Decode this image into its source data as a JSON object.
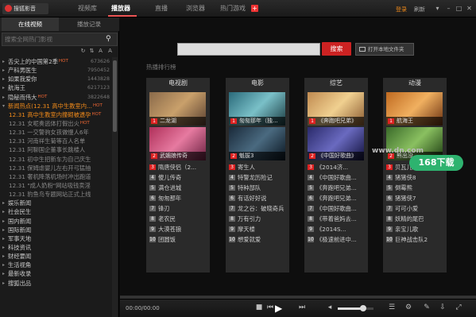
{
  "topbar": {
    "logo_label": "搜狐影音",
    "tabs": [
      "视频库",
      "播放器",
      "直播",
      "浏览器",
      "热门游戏"
    ],
    "active_tab": "播放器",
    "login": "登录",
    "refresh": "刷新"
  },
  "sidebar": {
    "tabs": [
      "在线视频",
      "播放记录"
    ],
    "search_placeholder": "搜索全网热门影视",
    "items": [
      {
        "label": "舌尖上的中国第2季",
        "hot": "HOT",
        "count": "673626"
      },
      {
        "label": "产科男医生",
        "count": "7950452"
      },
      {
        "label": "如果我爱你",
        "count": "1443828"
      },
      {
        "label": "航海王",
        "count": "6217123"
      },
      {
        "label": "隐秘而伟大",
        "hot": "HOT",
        "count": "3822648"
      }
    ],
    "news_header": {
      "label": "新闻热点(12.31 高中生教室内...",
      "hot": "HOT"
    },
    "news": [
      {
        "date": "12.31",
        "label": "高中生教室内撞砌被遗孕",
        "hot": "HOT",
        "highlight": true
      },
      {
        "date": "12.31",
        "label": "女呢奏逃体打假出火",
        "hot": "HOT"
      },
      {
        "date": "12.31",
        "label": "一交警驹女孩做慢人6年"
      },
      {
        "date": "12.31",
        "label": "河南祥生菊等百人名单"
      },
      {
        "date": "12.31",
        "label": "阿聊国企董事长跳楼人"
      },
      {
        "date": "12.31",
        "label": "初中生招新车为自己庆生"
      },
      {
        "date": "12.31",
        "label": "保姆虐婴儿左右开弓猛抽"
      },
      {
        "date": "12.31",
        "label": "奢机降落机场时冲出跑道"
      },
      {
        "date": "12.31",
        "label": "\"成人奶粉\"网站吸钱卖淫"
      },
      {
        "date": "12.31",
        "label": "豹鱼鸟专题网站正式上线"
      }
    ],
    "categories": [
      "娱乐新闻",
      "社会民生",
      "国内新闻",
      "国际新闻",
      "军事天地",
      "科技资讯",
      "财经要闻",
      "生活视角",
      "最新收录",
      "搜狐出品"
    ]
  },
  "main": {
    "search_button": "搜索",
    "open_folder": "打开本地文件夹",
    "rank_title": "热播排行榜",
    "columns": [
      {
        "title": "电视剧",
        "posters": [
          "二龙湖",
          "武媚娘传奇"
        ],
        "items": [
          "隋唐侠侣（2...",
          "傻儿传奇",
          "满仓进城",
          "匆匆那年",
          "锋刃",
          "老农民",
          "大漠苍狼",
          "团圆饭"
        ]
      },
      {
        "title": "电影",
        "posters": [
          "匆匆那年（独...",
          "魁拔3"
        ],
        "items": [
          "寄生人",
          "特警龙历险记",
          "特种部队",
          "有话好好说",
          "龙之谷：破晓奇兵",
          "万有引力",
          "摩天楼",
          "想爱就爱"
        ]
      },
      {
        "title": "综艺",
        "posters": [
          "《奔跑吧兄弟》",
          "《中国好歌曲》"
        ],
        "items": [
          "《2014济...",
          "《中国好歌曲...",
          "《奔跑吧兄弟...",
          "《奔跑吧兄弟...",
          "《中国好歌曲...",
          "《带着爸妈去...",
          "《2014S...",
          "《极速前进中..."
        ]
      },
      {
        "title": "动漫",
        "posters": [
          "航海王",
          "熊出没"
        ],
        "items": [
          "贝瓦儿歌",
          "猪猪侠8",
          "倒霉熊",
          "猪猪侠7",
          "可可小爱",
          "妖精的尾巴",
          "亲宝儿歌",
          "巨神战击队2"
        ]
      }
    ]
  },
  "watermark": {
    "site": "www.dn.com",
    "brand": "168下载"
  },
  "player": {
    "time": "00:00/00:00",
    "progress": 0.0,
    "volume": 0.7
  }
}
